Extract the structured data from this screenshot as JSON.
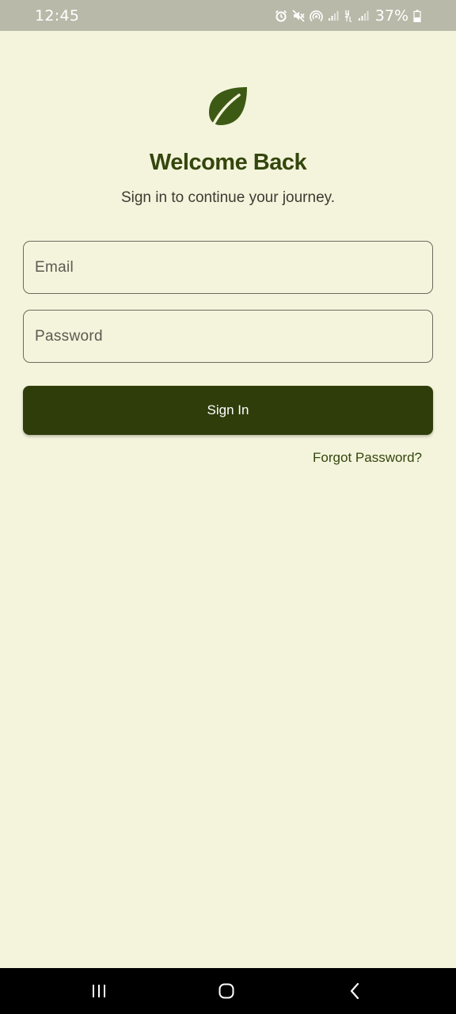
{
  "status_bar": {
    "time": "12:45",
    "battery": "37%",
    "icons": [
      "alarm-icon",
      "mute-icon",
      "hotspot-icon",
      "signal-icon",
      "data-4g-icon",
      "signal-icon",
      "battery-icon"
    ]
  },
  "login": {
    "title": "Welcome Back",
    "subtitle": "Sign in to continue your journey.",
    "email_placeholder": "Email",
    "email_value": "",
    "password_placeholder": "Password",
    "password_value": "",
    "signin_label": "Sign In",
    "forgot_label": "Forgot Password?"
  },
  "nav_bar": {
    "buttons": [
      "recents-icon",
      "home-icon",
      "back-icon"
    ]
  },
  "colors": {
    "background": "#f4f4dc",
    "accent": "#34460d",
    "button": "#2f3d0b",
    "leaf": "#3d5a14",
    "status_bar": "#b9b9a9"
  }
}
